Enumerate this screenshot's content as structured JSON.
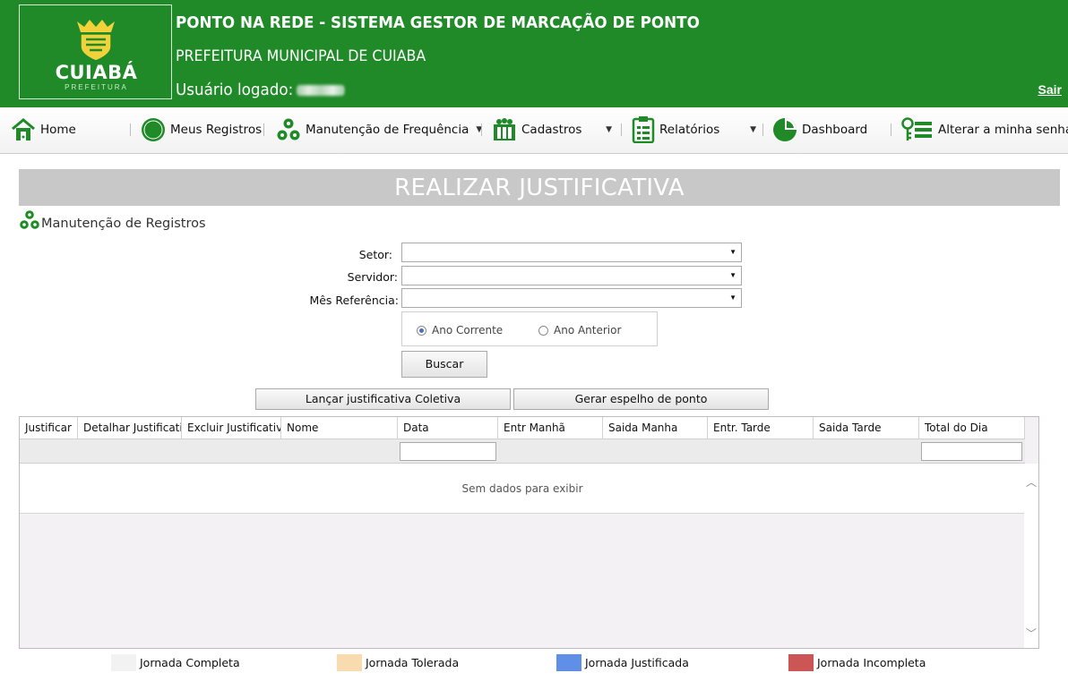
{
  "header": {
    "logo_text": "CUIABÁ",
    "logo_subtext": "PREFEITURA",
    "title": "PONTO NA REDE - SISTEMA GESTOR DE MARCAÇÃO DE PONTO",
    "subtitle": "PREFEITURA MUNICIPAL DE CUIABA",
    "user_label": "Usuário logado:",
    "logout_label": "Sair"
  },
  "menu": {
    "home": "Home",
    "meus_registros": "Meus Registros",
    "manutencao": "Manutenção de Frequência",
    "cadastros": "Cadastros",
    "relatorios": "Relatórios",
    "dashboard": "Dashboard",
    "alterar_senha": "Alterar a minha senha"
  },
  "page": {
    "title": "REALIZAR JUSTIFICATIVA",
    "section": "Manutenção de Registros"
  },
  "form": {
    "setor_label": "Setor:",
    "servidor_label": "Servidor:",
    "mes_label": "Mês Referência:",
    "radio_current": "Ano Corrente",
    "radio_previous": "Ano Anterior",
    "search_button": "Buscar",
    "coletiva_button": "Lançar justificativa Coletiva",
    "espelho_button": "Gerar espelho de ponto"
  },
  "grid": {
    "columns": [
      "Justificar",
      "Detalhar Justificativa",
      "Excluir Justificativa",
      "Nome",
      "Data",
      "Entr Manhã",
      "Saida Manha",
      "Entr. Tarde",
      "Saida Tarde",
      "Total do Dia"
    ],
    "empty_text": "Sem dados para exibir"
  },
  "legend": {
    "items": [
      {
        "label": "Jornada Completa",
        "color": "#f2f2f2"
      },
      {
        "label": "Jornada Tolerada",
        "color": "#f8dcb0"
      },
      {
        "label": "Jornada Justificada",
        "color": "#5f8fe6"
      },
      {
        "label": "Jornada Incompleta",
        "color": "#cc5555"
      }
    ]
  },
  "colors": {
    "brand_green": "#1f8a27",
    "title_bar": "#c8c8c8"
  }
}
